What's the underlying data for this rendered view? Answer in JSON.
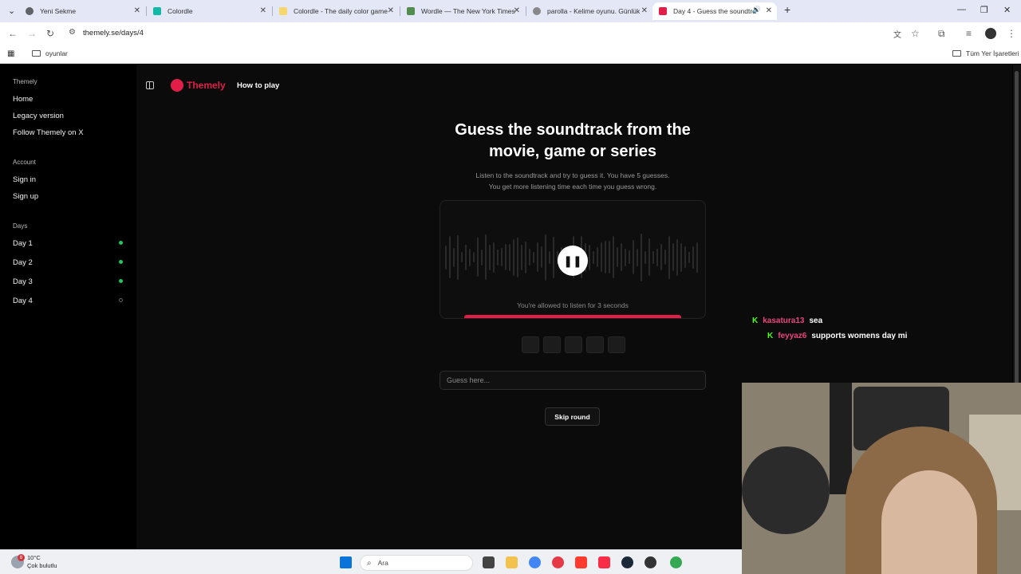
{
  "browser": {
    "tabs": [
      {
        "title": "Yeni Sekme",
        "color": "#5f6368"
      },
      {
        "title": "Colordle",
        "color": "#14b8a6"
      },
      {
        "title": "Colordle - The daily color game",
        "color": "#f5d76e"
      },
      {
        "title": "Wordle — The New York Times",
        "color": "#538d4e"
      },
      {
        "title": "parolla - Kelime oyunu. Günlük",
        "color": "#888888"
      },
      {
        "title": "Day 4 - Guess the soundtra",
        "color": "#e11d48"
      }
    ],
    "url": "themely.se/days/4",
    "bookmark_folder": "oyunlar",
    "all_bookmarks": "Tüm Yer İşaretleri"
  },
  "sidebar": {
    "section_app": "Themely",
    "app_items": [
      "Home",
      "Legacy version",
      "Follow Themely on X"
    ],
    "section_account": "Account",
    "account_items": [
      "Sign in",
      "Sign up"
    ],
    "section_days": "Days",
    "days": [
      {
        "label": "Day 1",
        "done": true
      },
      {
        "label": "Day 2",
        "done": true
      },
      {
        "label": "Day 3",
        "done": true
      },
      {
        "label": "Day 4",
        "done": false
      }
    ]
  },
  "header": {
    "logo": "Themely",
    "how_to_play": "How to play"
  },
  "game": {
    "title": "Guess the soundtrack from the movie, game or series",
    "desc_line1": "Listen to the soundtrack and try to guess it. You have 5 guesses.",
    "desc_line2": "You get more listening time each time you guess wrong.",
    "play_state": "pause",
    "play_icon": "❚❚",
    "allowed": "You're allowed to listen for 3 seconds",
    "guess_placeholder": "Guess here...",
    "skip": "Skip round",
    "guess_slots": 5
  },
  "overlay": {
    "chat": [
      {
        "user": "kasatura13",
        "message": "sea"
      },
      {
        "user": "feyyaz6",
        "message": "supports womens day mi"
      }
    ]
  },
  "taskbar": {
    "weather_temp": "10°C",
    "weather_desc": "Çok bulutlu",
    "weather_badge": "8",
    "search": "Ara"
  },
  "colors": {
    "accent": "#e11d48",
    "done_dot": "#22c55e",
    "chat_name": "#e8467c",
    "kick_green": "#53fc18"
  }
}
